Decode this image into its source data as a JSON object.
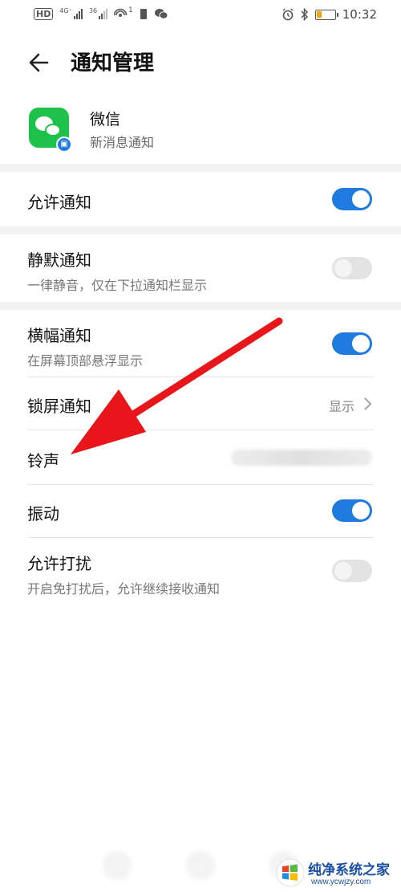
{
  "status_bar": {
    "hd_badge": "HD",
    "signal1_label": "4G⁺",
    "signal2_label": "36",
    "hotspot_label": "1",
    "time": "10:32"
  },
  "header": {
    "title": "通知管理",
    "back_icon": "arrow-left-icon"
  },
  "app": {
    "name": "微信",
    "subtitle": "新消息通知",
    "icon": "wechat-icon",
    "badge_icon": "app-twin-icon"
  },
  "settings": {
    "allow": {
      "label": "允许通知",
      "enabled": true
    },
    "silent": {
      "label": "静默通知",
      "desc": "一律静音，仅在下拉通知栏显示",
      "enabled": false
    },
    "banner": {
      "label": "横幅通知",
      "desc": "在屏幕顶部悬浮显示",
      "enabled": true
    },
    "lockscreen": {
      "label": "锁屏通知",
      "value": "显示"
    },
    "ringtone": {
      "label": "铃声"
    },
    "vibrate": {
      "label": "振动",
      "enabled": true
    },
    "dnd": {
      "label": "允许打扰",
      "desc": "开启免打扰后，允许继续接收通知",
      "enabled": false
    }
  },
  "watermark": {
    "title": "纯净系统之家",
    "url": "www.ycwjzy.com"
  },
  "colors": {
    "accent": "#1f7be0",
    "toggle_off": "#e3e3e3",
    "annotation_arrow": "#e8161a",
    "wechat_green": "#1ec24a"
  }
}
